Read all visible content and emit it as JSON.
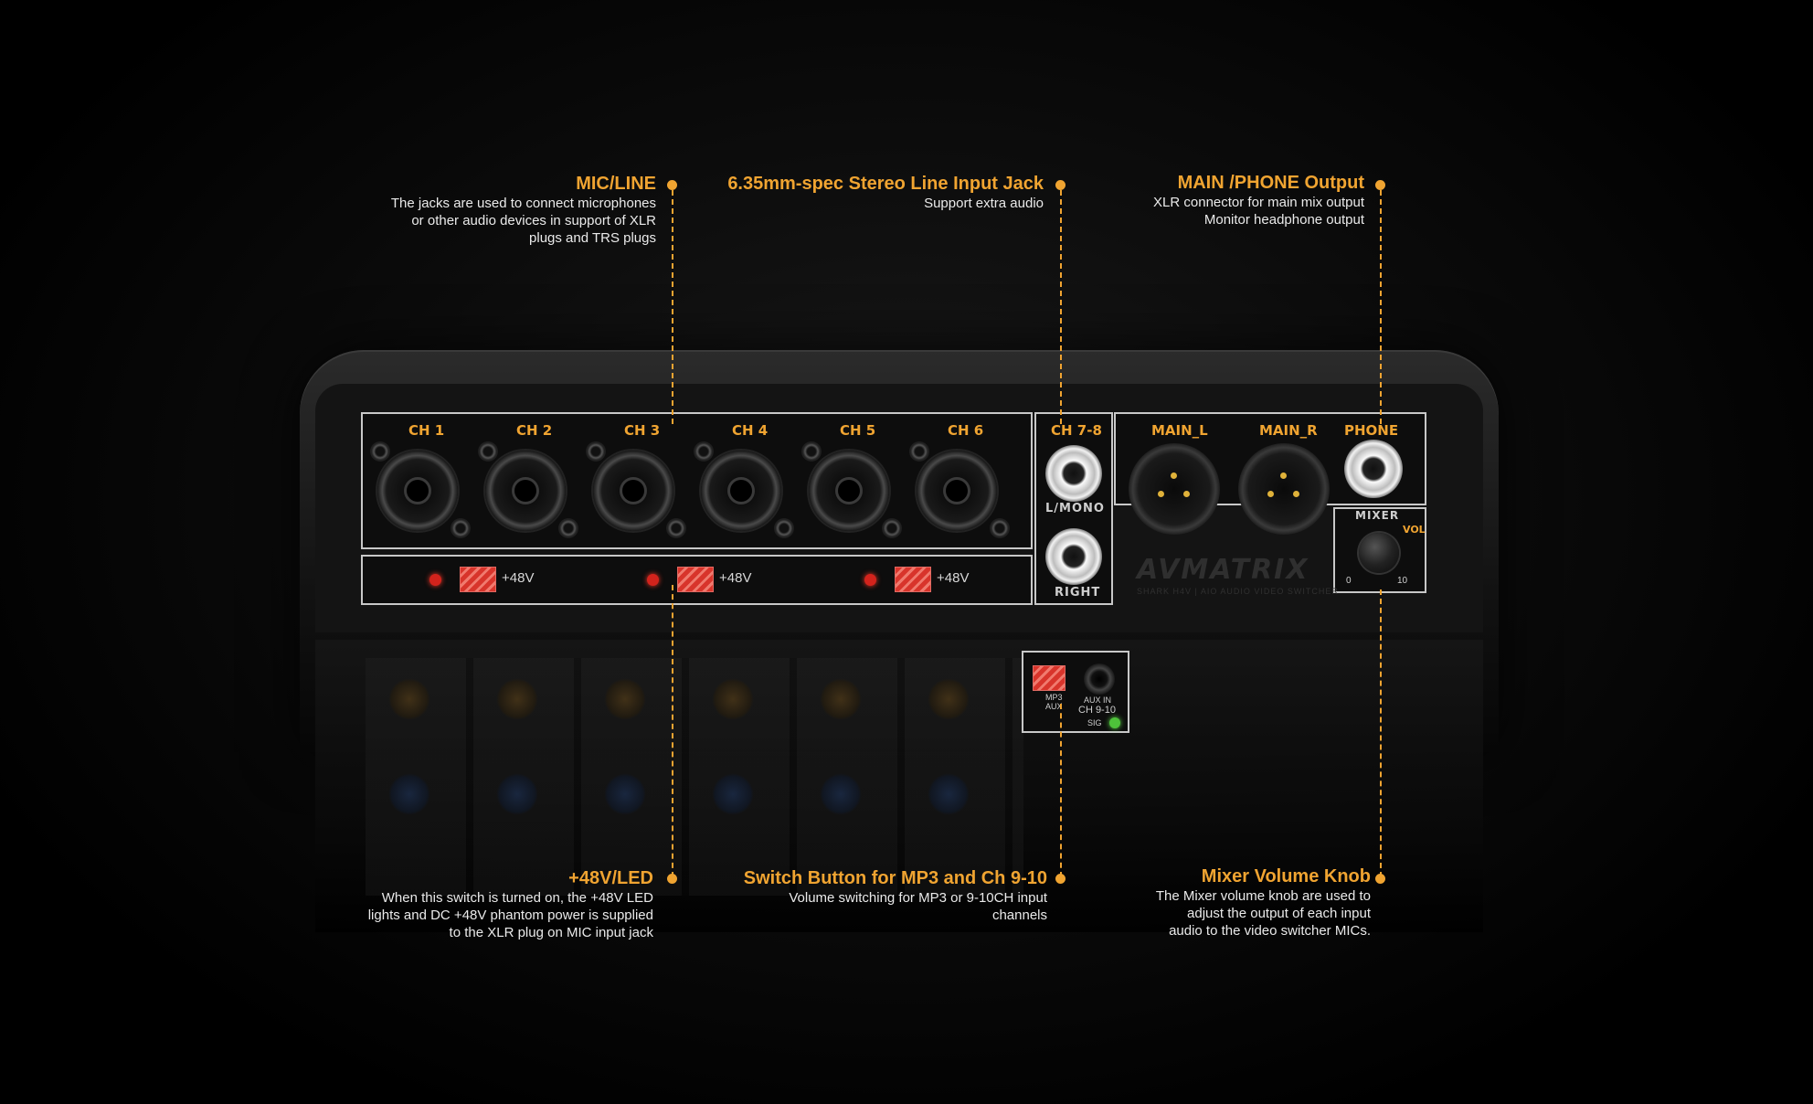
{
  "callouts": {
    "mic_line": {
      "title": "MIC/LINE",
      "desc": [
        "The jacks are used to connect microphones",
        "or other audio devices in support of XLR",
        "plugs and TRS plugs"
      ]
    },
    "stereo_jack": {
      "title": "6.35mm-spec Stereo Line Input Jack",
      "desc": [
        "Support extra audio"
      ]
    },
    "main_phone": {
      "title": "MAIN /PHONE Output",
      "desc": [
        "XLR connector for main mix output",
        "Monitor headphone output"
      ]
    },
    "phantom": {
      "title": "+48V/LED",
      "desc": [
        "When this switch is turned on, the +48V LED",
        "lights and DC +48V phantom power is supplied",
        "to the XLR plug on MIC input jack"
      ]
    },
    "switch_button": {
      "title": "Switch Button for MP3 and Ch 9-10",
      "desc": [
        "Volume switching for MP3 or 9-10CH input",
        "channels"
      ]
    },
    "mixer_knob": {
      "title": "Mixer Volume Knob",
      "desc": [
        "The Mixer volume knob are used to",
        "adjust the output of each input",
        "audio to the video switcher MICs."
      ]
    }
  },
  "device": {
    "channels": [
      "CH 1",
      "CH 2",
      "CH 3",
      "CH 4",
      "CH 5",
      "CH 6"
    ],
    "phantom_label": "+48V",
    "ch78": {
      "label": "CH 7-8",
      "left": "L/MONO",
      "right": "RIGHT"
    },
    "outputs": {
      "main_l": "MAIN_L",
      "main_r": "MAIN_R",
      "phone": "PHONE"
    },
    "mixer": {
      "label": "MIXER",
      "vol": "VOL",
      "min": "0",
      "max": "10"
    },
    "aux": {
      "mp3": "MP3",
      "aux": "AUX",
      "aux_in": "AUX IN",
      "ch910": "CH 9-10",
      "sig": "SIG"
    },
    "logo": "AVMATRIX",
    "logo_sub": "SHARK H4V | AIO AUDIO VIDEO SWITCHER"
  },
  "colors": {
    "accent": "#f0a431",
    "led_red": "#d3231c",
    "led_green": "#4ec23a"
  }
}
